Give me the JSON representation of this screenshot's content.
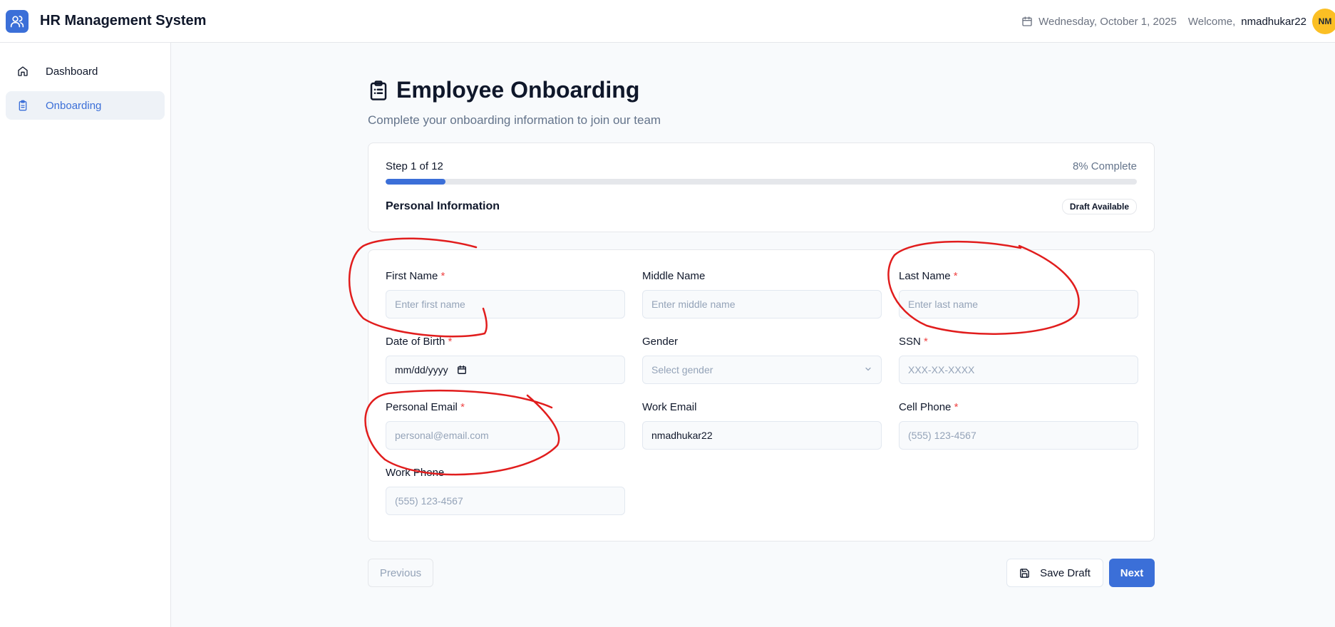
{
  "header": {
    "app_title": "HR Management System",
    "date": "Wednesday, October 1, 2025",
    "welcome": "Welcome,",
    "username": "nmadhukar22",
    "avatar_initials": "NM"
  },
  "sidebar": {
    "items": [
      {
        "label": "Dashboard",
        "icon": "home-icon",
        "active": false
      },
      {
        "label": "Onboarding",
        "icon": "clipboard-icon",
        "active": true
      }
    ]
  },
  "page": {
    "title": "Employee Onboarding",
    "subtitle": "Complete your onboarding information to join our team"
  },
  "progress": {
    "step_text": "Step 1 of 12",
    "percent_text": "8% Complete",
    "percent": 8,
    "section_title": "Personal Information",
    "badge": "Draft Available"
  },
  "form": {
    "first_name": {
      "label": "First Name",
      "required": "*",
      "placeholder": "Enter first name"
    },
    "middle_name": {
      "label": "Middle Name",
      "placeholder": "Enter middle name"
    },
    "last_name": {
      "label": "Last Name",
      "required": "*",
      "placeholder": "Enter last name"
    },
    "dob": {
      "label": "Date of Birth",
      "required": "*",
      "placeholder": "mm/dd/yyyy"
    },
    "gender": {
      "label": "Gender",
      "placeholder": "Select gender"
    },
    "ssn": {
      "label": "SSN",
      "required": "*",
      "placeholder": "XXX-XX-XXXX"
    },
    "personal_email": {
      "label": "Personal Email",
      "required": "*",
      "placeholder": "personal@email.com"
    },
    "work_email": {
      "label": "Work Email",
      "value": "nmadhukar22"
    },
    "cell_phone": {
      "label": "Cell Phone",
      "required": "*",
      "placeholder": "(555) 123-4567"
    },
    "work_phone": {
      "label": "Work Phone",
      "placeholder": "(555) 123-4567"
    }
  },
  "actions": {
    "previous": "Previous",
    "save_draft": "Save Draft",
    "next": "Next"
  },
  "colors": {
    "accent": "#3b6fd8",
    "required": "#ef4444",
    "annotation": "#e11d1d",
    "avatar": "#fbbf24"
  }
}
